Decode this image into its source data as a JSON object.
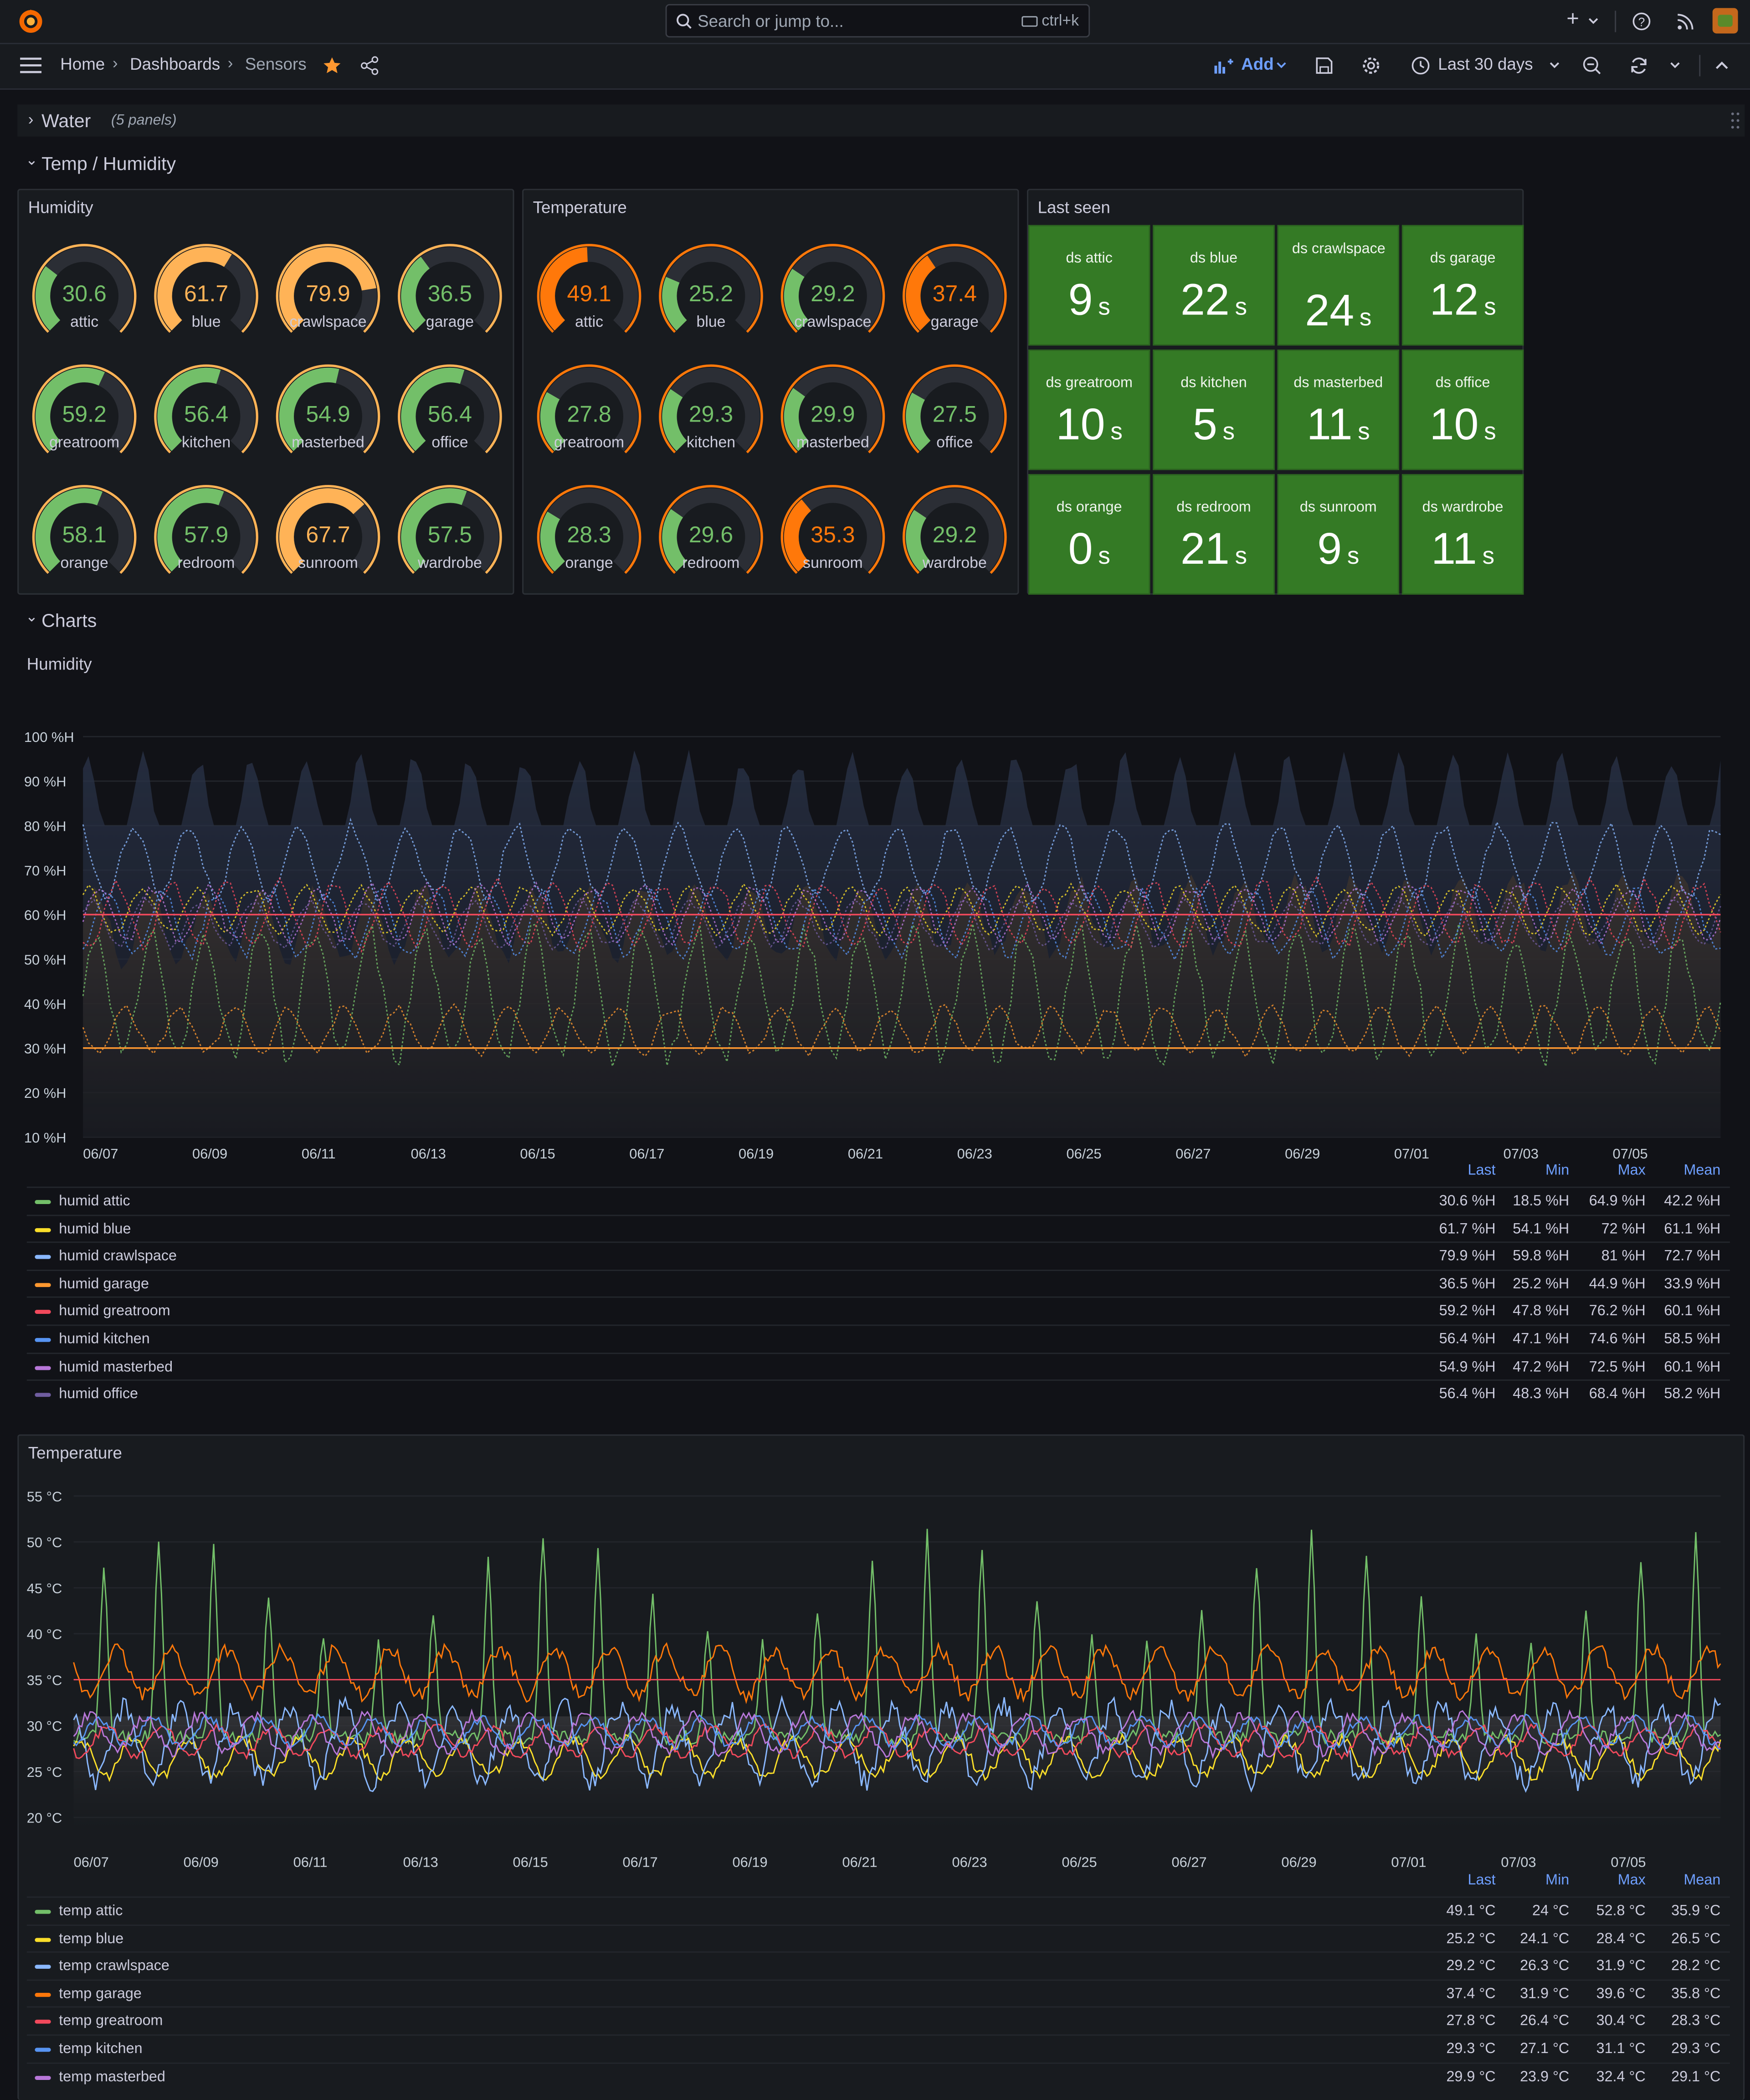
{
  "topbar": {
    "search_placeholder": "Search or jump to...",
    "shortcut": "ctrl+k"
  },
  "breadcrumb": {
    "home": "Home",
    "dashboards": "Dashboards",
    "current": "Sensors"
  },
  "toolbar": {
    "add_label": "Add",
    "time_range": "Last 30 days"
  },
  "rows": {
    "water": {
      "title": "Water",
      "panel_count": "(5 panels)"
    },
    "temp_humidity": {
      "title": "Temp / Humidity"
    },
    "charts": {
      "title": "Charts"
    }
  },
  "humidity_gauges": {
    "title": "Humidity",
    "unit_max": 100,
    "items": [
      {
        "label": "attic",
        "value": "30.6",
        "color": "green"
      },
      {
        "label": "blue",
        "value": "61.7",
        "color": "orange"
      },
      {
        "label": "crawlspace",
        "value": "79.9",
        "color": "orange"
      },
      {
        "label": "garage",
        "value": "36.5",
        "color": "green"
      },
      {
        "label": "greatroom",
        "value": "59.2",
        "color": "green"
      },
      {
        "label": "kitchen",
        "value": "56.4",
        "color": "green"
      },
      {
        "label": "masterbed",
        "value": "54.9",
        "color": "green"
      },
      {
        "label": "office",
        "value": "56.4",
        "color": "green"
      },
      {
        "label": "orange",
        "value": "58.1",
        "color": "green"
      },
      {
        "label": "redroom",
        "value": "57.9",
        "color": "green"
      },
      {
        "label": "sunroom",
        "value": "67.7",
        "color": "orange"
      },
      {
        "label": "wardrobe",
        "value": "57.5",
        "color": "green"
      }
    ]
  },
  "temperature_gauges": {
    "title": "Temperature",
    "unit_max": 100,
    "items": [
      {
        "label": "attic",
        "value": "49.1",
        "color": "orange"
      },
      {
        "label": "blue",
        "value": "25.2",
        "color": "green"
      },
      {
        "label": "crawlspace",
        "value": "29.2",
        "color": "green"
      },
      {
        "label": "garage",
        "value": "37.4",
        "color": "orange"
      },
      {
        "label": "greatroom",
        "value": "27.8",
        "color": "green"
      },
      {
        "label": "kitchen",
        "value": "29.3",
        "color": "green"
      },
      {
        "label": "masterbed",
        "value": "29.9",
        "color": "green"
      },
      {
        "label": "office",
        "value": "27.5",
        "color": "green"
      },
      {
        "label": "orange",
        "value": "28.3",
        "color": "green"
      },
      {
        "label": "redroom",
        "value": "29.6",
        "color": "green"
      },
      {
        "label": "sunroom",
        "value": "35.3",
        "color": "orange"
      },
      {
        "label": "wardrobe",
        "value": "29.2",
        "color": "green"
      }
    ]
  },
  "last_seen": {
    "title": "Last seen",
    "unit": "s",
    "items": [
      {
        "label": "ds attic",
        "value": "9"
      },
      {
        "label": "ds blue",
        "value": "22"
      },
      {
        "label": "ds crawlspace",
        "value": "24"
      },
      {
        "label": "ds garage",
        "value": "12"
      },
      {
        "label": "ds greatroom",
        "value": "10"
      },
      {
        "label": "ds kitchen",
        "value": "5"
      },
      {
        "label": "ds masterbed",
        "value": "11"
      },
      {
        "label": "ds office",
        "value": "10"
      },
      {
        "label": "ds orange",
        "value": "0"
      },
      {
        "label": "ds redroom",
        "value": "21"
      },
      {
        "label": "ds sunroom",
        "value": "9"
      },
      {
        "label": "ds wardrobe",
        "value": "11"
      }
    ]
  },
  "colors": {
    "green": "#73bf69",
    "orange": "#ff780a",
    "light_orange": "#ffb357",
    "tile_green": "#347a25",
    "link_blue": "#6e9fff"
  },
  "chart_data": [
    {
      "type": "area",
      "title": "Humidity",
      "y_ticks": [
        "100 %H",
        "90 %H",
        "80 %H",
        "70 %H",
        "60 %H",
        "50 %H",
        "40 %H",
        "30 %H",
        "20 %H",
        "10 %H"
      ],
      "ylim": [
        10,
        100
      ],
      "x_ticks": [
        "06/07",
        "06/09",
        "06/11",
        "06/13",
        "06/15",
        "06/17",
        "06/19",
        "06/21",
        "06/23",
        "06/25",
        "06/27",
        "06/29",
        "07/01",
        "07/03",
        "07/05"
      ],
      "thresholds": [
        {
          "value": 60,
          "color": "#f2495c"
        },
        {
          "value": 30,
          "color": "#ff9830"
        }
      ],
      "legend_columns": [
        "Last",
        "Min",
        "Max",
        "Mean"
      ],
      "series": [
        {
          "name": "humid attic",
          "color": "#73bf69",
          "last": "30.6 %H",
          "min": "18.5 %H",
          "max": "64.9 %H",
          "mean": "42.2 %H"
        },
        {
          "name": "humid blue",
          "color": "#fade2a",
          "last": "61.7 %H",
          "min": "54.1 %H",
          "max": "72 %H",
          "mean": "61.1 %H"
        },
        {
          "name": "humid crawlspace",
          "color": "#8ab8ff",
          "last": "79.9 %H",
          "min": "59.8 %H",
          "max": "81 %H",
          "mean": "72.7 %H"
        },
        {
          "name": "humid garage",
          "color": "#ff9830",
          "last": "36.5 %H",
          "min": "25.2 %H",
          "max": "44.9 %H",
          "mean": "33.9 %H"
        },
        {
          "name": "humid greatroom",
          "color": "#f2495c",
          "last": "59.2 %H",
          "min": "47.8 %H",
          "max": "76.2 %H",
          "mean": "60.1 %H"
        },
        {
          "name": "humid kitchen",
          "color": "#5794f2",
          "last": "56.4 %H",
          "min": "47.1 %H",
          "max": "74.6 %H",
          "mean": "58.5 %H"
        },
        {
          "name": "humid masterbed",
          "color": "#b877d9",
          "last": "54.9 %H",
          "min": "47.2 %H",
          "max": "72.5 %H",
          "mean": "60.1 %H"
        },
        {
          "name": "humid office",
          "color": "#705da0",
          "last": "56.4 %H",
          "min": "48.3 %H",
          "max": "68.4 %H",
          "mean": "58.2 %H"
        }
      ]
    },
    {
      "type": "line",
      "title": "Temperature",
      "y_ticks": [
        "55 °C",
        "50 °C",
        "45 °C",
        "40 °C",
        "35 °C",
        "30 °C",
        "25 °C",
        "20 °C"
      ],
      "ylim": [
        20,
        55
      ],
      "x_ticks": [
        "06/07",
        "06/09",
        "06/11",
        "06/13",
        "06/15",
        "06/17",
        "06/19",
        "06/21",
        "06/23",
        "06/25",
        "06/27",
        "06/29",
        "07/01",
        "07/03",
        "07/05"
      ],
      "thresholds": [
        {
          "value": 35,
          "color": "#f2495c"
        }
      ],
      "legend_columns": [
        "Last",
        "Min",
        "Max",
        "Mean"
      ],
      "series": [
        {
          "name": "temp attic",
          "color": "#73bf69",
          "last": "49.1 °C",
          "min": "24 °C",
          "max": "52.8 °C",
          "mean": "35.9 °C"
        },
        {
          "name": "temp blue",
          "color": "#fade2a",
          "last": "25.2 °C",
          "min": "24.1 °C",
          "max": "28.4 °C",
          "mean": "26.5 °C"
        },
        {
          "name": "temp crawlspace",
          "color": "#8ab8ff",
          "last": "29.2 °C",
          "min": "26.3 °C",
          "max": "31.9 °C",
          "mean": "28.2 °C"
        },
        {
          "name": "temp garage",
          "color": "#ff780a",
          "last": "37.4 °C",
          "min": "31.9 °C",
          "max": "39.6 °C",
          "mean": "35.8 °C"
        },
        {
          "name": "temp greatroom",
          "color": "#f2495c",
          "last": "27.8 °C",
          "min": "26.4 °C",
          "max": "30.4 °C",
          "mean": "28.3 °C"
        },
        {
          "name": "temp kitchen",
          "color": "#5794f2",
          "last": "29.3 °C",
          "min": "27.1 °C",
          "max": "31.1 °C",
          "mean": "29.3 °C"
        },
        {
          "name": "temp masterbed",
          "color": "#b877d9",
          "last": "29.9 °C",
          "min": "23.9 °C",
          "max": "32.4 °C",
          "mean": "29.1 °C"
        }
      ]
    }
  ]
}
